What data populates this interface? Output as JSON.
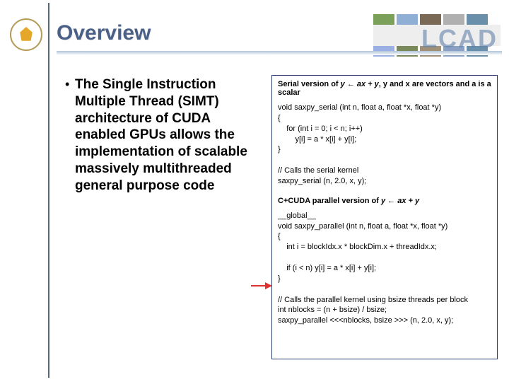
{
  "header": {
    "title": "Overview",
    "logo_text": "LCAD"
  },
  "bullet": {
    "text": "The Single Instruction Multiple Thread (SIMT) architecture of CUDA enabled GPUs allows the implementation of scalable massively multithreaded general purpose code"
  },
  "code": {
    "caption_serial_prefix": "Serial version of ",
    "caption_serial_expr": "y ← ax + y",
    "caption_serial_suffix": ", y and x are vectors and a is a scalar",
    "serial_block": "void saxpy_serial (int n, float a, float *x, float *y)\n{\n    for (int i = 0; i < n; i++)\n        y[i] = a * x[i] + y[i];\n}\n\n// Calls the serial kernel\nsaxpy_serial (n, 2.0, x, y);",
    "caption_parallel_prefix": "C+CUDA parallel version of ",
    "caption_parallel_expr": "y ← ax + y",
    "parallel_block": "__global__\nvoid saxpy_parallel (int n, float a, float *x, float *y)\n{\n    int i = blockIdx.x * blockDim.x + threadIdx.x;\n\n    if (i < n) y[i] = a * x[i] + y[i];\n}\n\n// Calls the parallel kernel using bsize threads per block\nint nblocks = (n + bsize) / bsize;\nsaxpy_parallel <<<nblocks, bsize >>> (n, 2.0, x, y);"
  }
}
